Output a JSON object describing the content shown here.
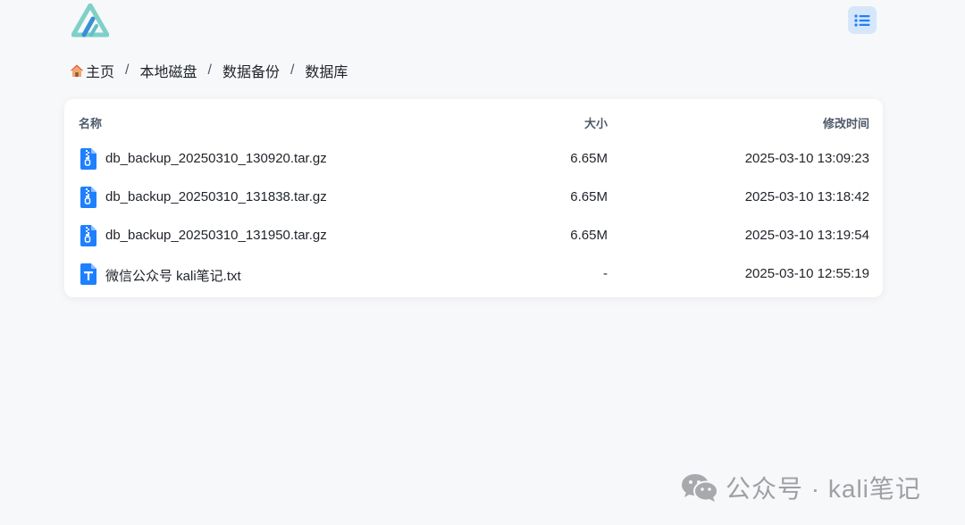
{
  "header": {
    "logo_icon": "stacked-triangle-logo",
    "view_toggle_icon": "list-icon",
    "accent_color": "#1e80ff"
  },
  "breadcrumb": {
    "home_icon": "house-icon",
    "items": [
      "主页",
      "本地磁盘",
      "数据备份",
      "数据库"
    ],
    "separator": "/"
  },
  "table": {
    "columns": {
      "name": "名称",
      "size": "大小",
      "modified": "修改时间"
    },
    "rows": [
      {
        "icon": "zip-file-icon",
        "name": "db_backup_20250310_130920.tar.gz",
        "size": "6.65M",
        "modified": "2025-03-10 13:09:23"
      },
      {
        "icon": "zip-file-icon",
        "name": "db_backup_20250310_131838.tar.gz",
        "size": "6.65M",
        "modified": "2025-03-10 13:18:42"
      },
      {
        "icon": "zip-file-icon",
        "name": "db_backup_20250310_131950.tar.gz",
        "size": "6.65M",
        "modified": "2025-03-10 13:19:54"
      },
      {
        "icon": "text-file-icon",
        "name": "微信公众号 kali笔记.txt",
        "size": "-",
        "modified": "2025-03-10 12:55:19"
      }
    ]
  },
  "watermark": {
    "icon": "wechat-icon",
    "text": "公众号 · kali笔记"
  }
}
